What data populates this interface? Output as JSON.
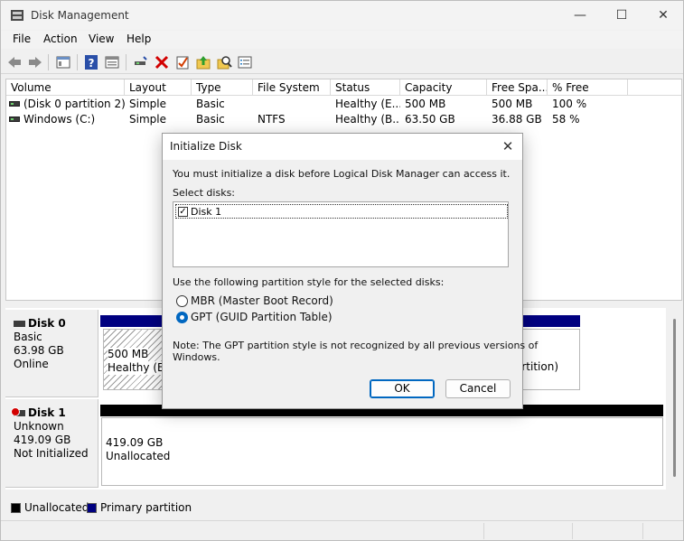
{
  "window": {
    "title": "Disk Management"
  },
  "caption": {
    "minimize": "—",
    "maximize": "☐",
    "close": "✕"
  },
  "menu": [
    "File",
    "Action",
    "View",
    "Help"
  ],
  "volume_list": {
    "columns": [
      "Volume",
      "Layout",
      "Type",
      "File System",
      "Status",
      "Capacity",
      "Free Spa...",
      "% Free"
    ],
    "rows": [
      {
        "volume": "(Disk 0 partition 2)",
        "layout": "Simple",
        "type": "Basic",
        "fs": "",
        "status": "Healthy (E...",
        "capacity": "500 MB",
        "free": "500 MB",
        "pct": "100 %"
      },
      {
        "volume": "Windows (C:)",
        "layout": "Simple",
        "type": "Basic",
        "fs": "NTFS",
        "status": "Healthy (B...",
        "capacity": "63.50 GB",
        "free": "36.88 GB",
        "pct": "58 %"
      }
    ]
  },
  "disks": [
    {
      "name": "Disk 0",
      "kind": "Basic",
      "size": "63.98 GB",
      "state": "Online",
      "partitions": [
        {
          "size": "500 MB",
          "status": "Healthy (EFI"
        },
        {
          "status_tail": "artition)"
        }
      ]
    },
    {
      "name": "Disk 1",
      "kind": "Unknown",
      "size": "419.09 GB",
      "state": "Not Initialized",
      "partitions": [
        {
          "size": "419.09 GB",
          "status": "Unallocated"
        }
      ]
    }
  ],
  "legend": [
    {
      "label": "Unallocated",
      "color": "#000000"
    },
    {
      "label": "Primary partition",
      "color": "#000080"
    }
  ],
  "dialog": {
    "title": "Initialize Disk",
    "intro": "You must initialize a disk before Logical Disk Manager can access it.",
    "select_label": "Select disks:",
    "disk_item": "Disk 1",
    "disk_checked": true,
    "style_label": "Use the following partition style for the selected disks:",
    "option_mbr": "MBR (Master Boot Record)",
    "option_gpt": "GPT (GUID Partition Table)",
    "selected_style": "GPT",
    "note_line1": "Note: The GPT partition style is not recognized by all previous versions of",
    "note_line2": "Windows.",
    "ok_label": "OK",
    "cancel_label": "Cancel",
    "close_glyph": "✕"
  },
  "icons": [
    "back-arrow-icon",
    "forward-arrow-icon",
    "console-tree-icon",
    "help-icon",
    "properties-icon",
    "connect-icon",
    "delete-icon",
    "check-icon",
    "up-folder-icon",
    "search-icon",
    "list-icon"
  ],
  "colors": {
    "primary_partition": "#000080",
    "unallocated": "#000000",
    "accent": "#0067c0",
    "delete": "#d20000"
  }
}
